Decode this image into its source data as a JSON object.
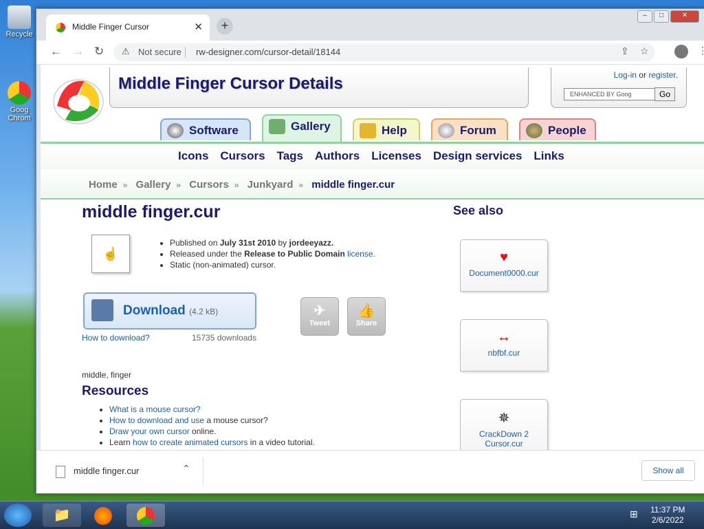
{
  "desktop": {
    "icons": [
      {
        "label": "Recycle"
      },
      {
        "label": "Goog Chrom"
      }
    ]
  },
  "browser": {
    "tab_title": "Middle Finger Cursor",
    "new_tab": "+",
    "security": "Not secure",
    "url": "rw-designer.com/cursor-detail/18144"
  },
  "site": {
    "header_title": "Middle Finger Cursor Details",
    "login": "Log-in",
    "or": "or",
    "register": "register.",
    "search_placeholder": "ENHANCED BY Goog",
    "search_go": "Go",
    "tabs": [
      {
        "label": "Software"
      },
      {
        "label": "Gallery"
      },
      {
        "label": "Help"
      },
      {
        "label": "Forum"
      },
      {
        "label": "People"
      }
    ],
    "nav": [
      "Icons",
      "Cursors",
      "Tags",
      "Authors",
      "Licenses",
      "Design services",
      "Links"
    ],
    "breadcrumb": [
      "Home",
      "Gallery",
      "Cursors",
      "Junkyard",
      "middle finger.cur"
    ]
  },
  "detail": {
    "title": "middle finger.cur",
    "published_prefix": "Published on",
    "published_date": "July 31st 2010",
    "published_by": "by",
    "author": "jordeeyazz.",
    "released_prefix": "Released under the",
    "release_license": "Release to Public Domain",
    "license_link": "license.",
    "static_note": "Static (non-animated) cursor.",
    "download_label": "Download",
    "download_size": "(4.2 kB)",
    "how_to_download": "How to download?",
    "downloads": "15735 downloads",
    "tweet": "Tweet",
    "share": "Share",
    "tags": "middle, finger"
  },
  "resources": {
    "heading": "Resources",
    "items": [
      {
        "link": "What is a mouse cursor?",
        "rest": ""
      },
      {
        "link": "How to download and use",
        "rest": " a mouse cursor?"
      },
      {
        "link": "Draw your own cursor",
        "rest": " online."
      },
      {
        "prefix": "Learn ",
        "link": "how to create animated cursors",
        "rest": " in a video tutorial."
      }
    ]
  },
  "see_also": {
    "heading": "See also",
    "items": [
      {
        "name": "Document0000.cur"
      },
      {
        "name": "nbfbf.cur"
      },
      {
        "name": "CrackDown 2 Cursor.cur"
      }
    ]
  },
  "downloads_bar": {
    "file": "middle finger.cur",
    "show_all": "Show all"
  },
  "taskbar": {
    "time": "11:37 PM",
    "date": "2/6/2022"
  }
}
